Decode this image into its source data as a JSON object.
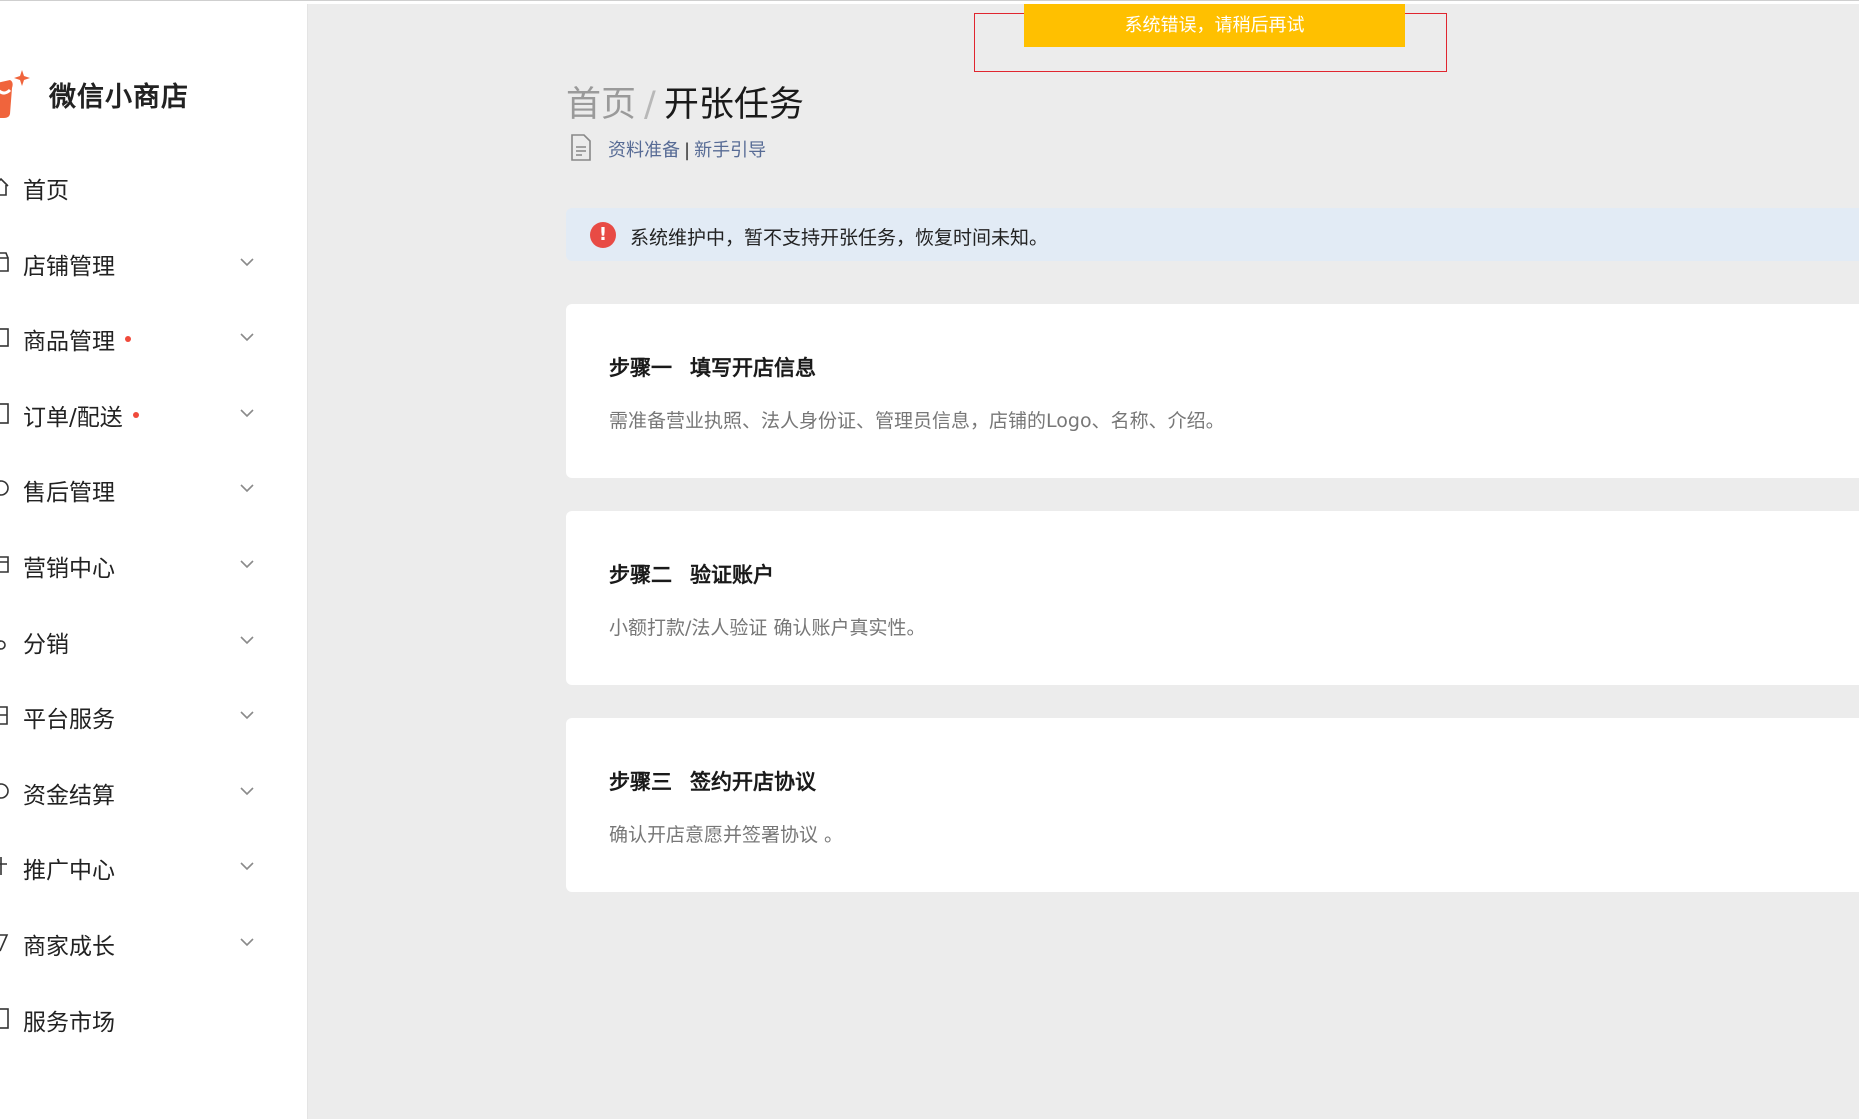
{
  "app": {
    "brand": "微信小商店",
    "accent_color": "#f0643c"
  },
  "sidebar": {
    "items": [
      {
        "label": "首页",
        "icon": "home-icon",
        "has_dot": false,
        "has_chevron": false
      },
      {
        "label": "店铺管理",
        "icon": "store-icon",
        "has_dot": false,
        "has_chevron": true
      },
      {
        "label": "商品管理",
        "icon": "goods-icon",
        "has_dot": true,
        "has_chevron": true
      },
      {
        "label": "订单/配送",
        "icon": "order-icon",
        "has_dot": true,
        "has_chevron": true
      },
      {
        "label": "售后管理",
        "icon": "aftersale-icon",
        "has_dot": false,
        "has_chevron": true
      },
      {
        "label": "营销中心",
        "icon": "marketing-icon",
        "has_dot": false,
        "has_chevron": true
      },
      {
        "label": "分销",
        "icon": "distribution-icon",
        "has_dot": false,
        "has_chevron": true
      },
      {
        "label": "平台服务",
        "icon": "platform-service-icon",
        "has_dot": false,
        "has_chevron": true
      },
      {
        "label": "资金结算",
        "icon": "settlement-icon",
        "has_dot": false,
        "has_chevron": true
      },
      {
        "label": "推广中心",
        "icon": "promotion-icon",
        "has_dot": false,
        "has_chevron": true
      },
      {
        "label": "商家成长",
        "icon": "growth-icon",
        "has_dot": false,
        "has_chevron": true
      },
      {
        "label": "服务市场",
        "icon": "service-market-icon",
        "has_dot": false,
        "has_chevron": false
      }
    ]
  },
  "breadcrumb": {
    "home": "首页",
    "separator": "/",
    "current": "开张任务"
  },
  "guide": {
    "link1": "资料准备",
    "separator": "|",
    "link2": "新手引导"
  },
  "alert": {
    "icon": "!",
    "text": "系统维护中，暂不支持开张任务，恢复时间未知。",
    "color": "#e84b45"
  },
  "steps": [
    {
      "number": "步骤一",
      "title": "填写开店信息",
      "desc": "需准备营业执照、法人身份证、管理员信息，店铺的Logo、名称、介绍。"
    },
    {
      "number": "步骤二",
      "title": "验证账户",
      "desc": "小额打款/法人验证 确认账户真实性。"
    },
    {
      "number": "步骤三",
      "title": "签约开店协议",
      "desc": "确认开店意愿并签署协议 。"
    }
  ],
  "toast": {
    "text": "系统错误，请稍后再试",
    "color": "#ffc000"
  }
}
